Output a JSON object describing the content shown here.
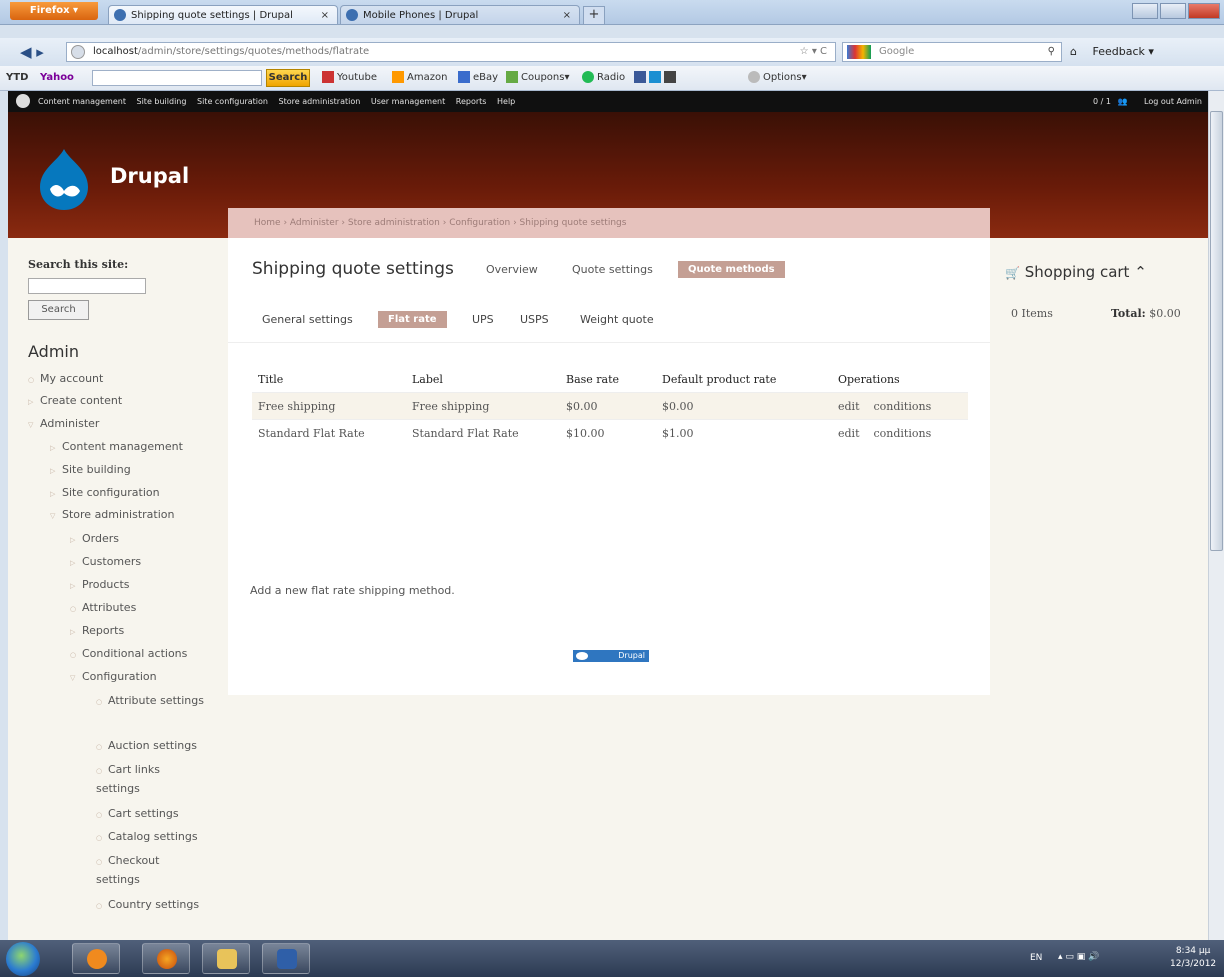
{
  "browser": {
    "app_button": "Firefox ▾",
    "tabs": [
      {
        "title": "Shipping quote settings | Drupal",
        "close": "×"
      },
      {
        "title": "Mobile Phones | Drupal",
        "close": "×"
      }
    ],
    "new_tab": "+",
    "url_host": "localhost",
    "url_path": "/admin/store/settings/quotes/methods/flatrate",
    "search_placeholder": "Google",
    "feedback": "Feedback ▾"
  },
  "toolbar": {
    "brand": "YTD",
    "yahoo": "Yahoo",
    "search_button": "Search",
    "links": [
      "Youtube",
      "Amazon",
      "eBay",
      "Coupons▾",
      "Radio",
      "Options▾"
    ]
  },
  "admin_menu": {
    "links": [
      "Content management",
      "Site building",
      "Site configuration",
      "Store administration",
      "User management",
      "Reports",
      "Help"
    ],
    "counter": "0 / 1",
    "logout": "Log out Admin"
  },
  "site": {
    "name": "Drupal",
    "breadcrumb": "Home › Administer › Store administration › Configuration › Shipping quote settings"
  },
  "sidebar": {
    "search_label": "Search this site:",
    "search_button": "Search",
    "title": "Admin",
    "menu": [
      "My account",
      "Create content",
      "Administer",
      "Content management",
      "Site building",
      "Site configuration",
      "Store administration",
      "Orders",
      "Customers",
      "Products",
      "Attributes",
      "Reports",
      "Conditional actions",
      "Configuration",
      "Attribute settings",
      "Auction settings",
      "Cart links settings",
      "Cart settings",
      "Catalog settings",
      "Checkout settings",
      "Country settings"
    ]
  },
  "main": {
    "title": "Shipping quote settings",
    "primary_tabs": [
      "Overview",
      "Quote settings",
      "Quote methods"
    ],
    "secondary_tabs": [
      "General settings",
      "Flat rate",
      "UPS",
      "USPS",
      "Weight quote"
    ],
    "table": {
      "headers": [
        "Title",
        "Label",
        "Base rate",
        "Default product rate",
        "Operations"
      ],
      "rows": [
        {
          "title": "Free shipping",
          "label": "Free shipping",
          "base": "$0.00",
          "default": "$0.00"
        },
        {
          "title": "Standard Flat Rate",
          "label": "Standard Flat Rate",
          "base": "$10.00",
          "default": "$1.00"
        }
      ],
      "op_edit": "edit",
      "op_conditions": "conditions"
    },
    "add_link": "Add a new flat rate shipping method.",
    "powered_by": "Drupal"
  },
  "cart": {
    "title": "Shopping cart",
    "items": "0 Items",
    "total_label": "Total:",
    "total_value": "$0.00"
  },
  "taskbar": {
    "lang": "EN",
    "time": "8:34 μμ",
    "date": "12/3/2012"
  }
}
